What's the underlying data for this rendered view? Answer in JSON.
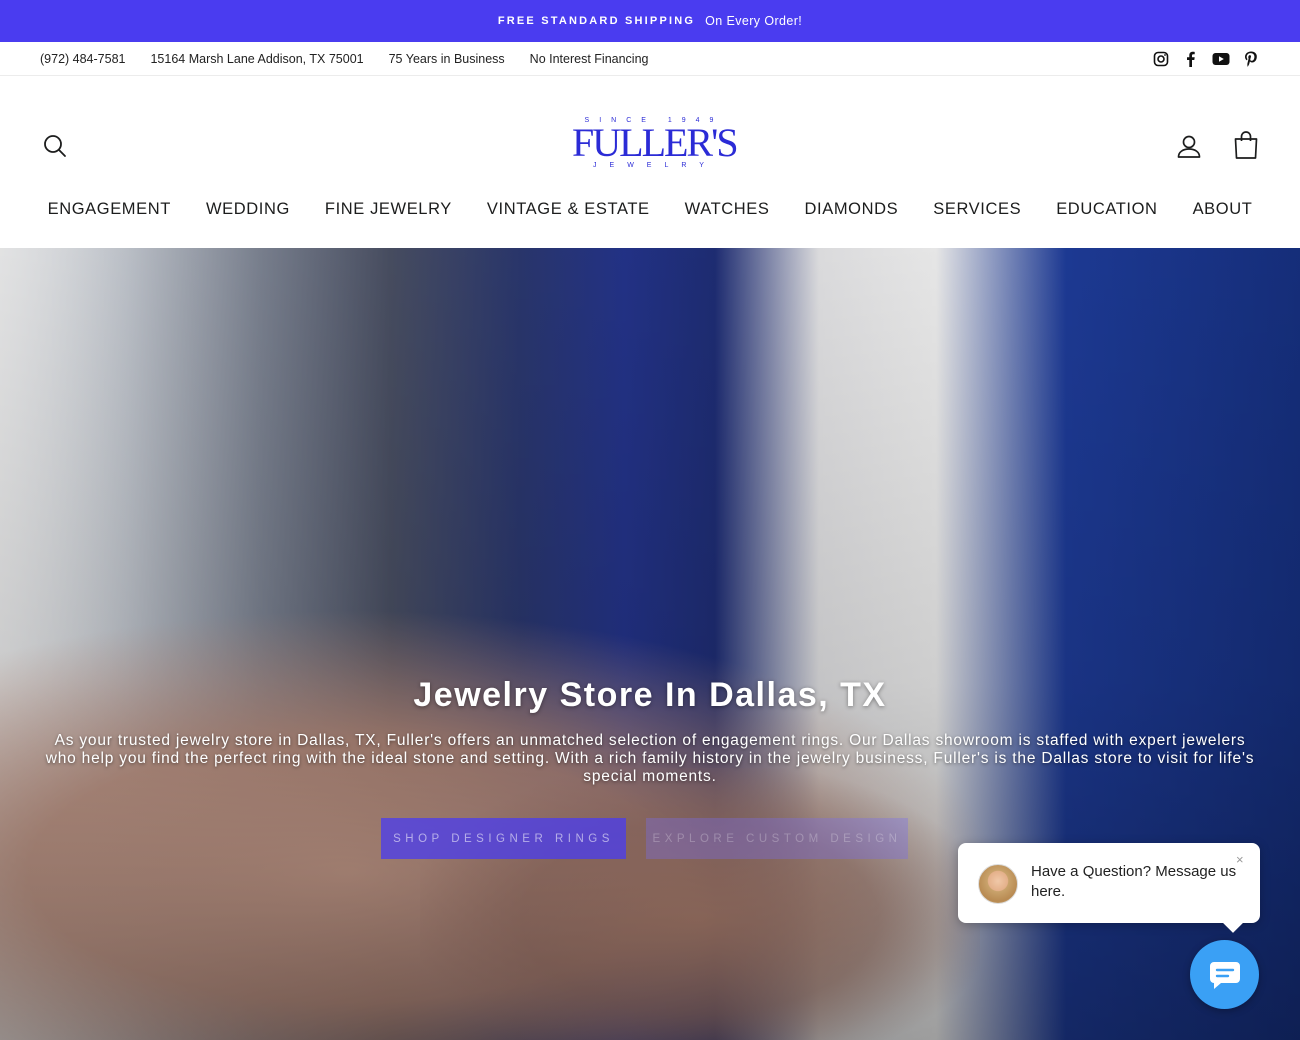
{
  "announcement": {
    "bold": "FREE STANDARD SHIPPING",
    "text": "On Every Order!"
  },
  "utility": {
    "phone": "(972) 484-7581",
    "address": "15164 Marsh Lane Addison, TX 75001",
    "years": "75 Years in Business",
    "financing": "No Interest Financing",
    "social": [
      "instagram-icon",
      "facebook-icon",
      "youtube-icon",
      "pinterest-icon"
    ]
  },
  "logo": {
    "since": "SINCE 1949",
    "name": "FULLER'S",
    "sub": "JEWELRY"
  },
  "nav": [
    "ENGAGEMENT",
    "WEDDING",
    "FINE JEWELRY",
    "VINTAGE & ESTATE",
    "WATCHES",
    "DIAMONDS",
    "SERVICES",
    "EDUCATION",
    "ABOUT"
  ],
  "hero": {
    "title": "Jewelry Store In Dallas, TX",
    "text": "As your trusted jewelry store in Dallas, TX, Fuller's offers an unmatched selection of engagement rings. Our Dallas showroom is staffed with expert jewelers who help you find the perfect ring with the ideal stone and setting. With a rich family history in the jewelry business, Fuller's is the Dallas store to visit for life's special moments.",
    "primary_button": "SHOP DESIGNER RINGS",
    "secondary_button": "EXPLORE CUSTOM DESIGN"
  },
  "chat": {
    "message": "Have a Question? Message us here.",
    "close": "×"
  },
  "colors": {
    "brand": "#4a3cf0",
    "logo": "#2b2bd6",
    "chat": "#3aa0f5"
  }
}
